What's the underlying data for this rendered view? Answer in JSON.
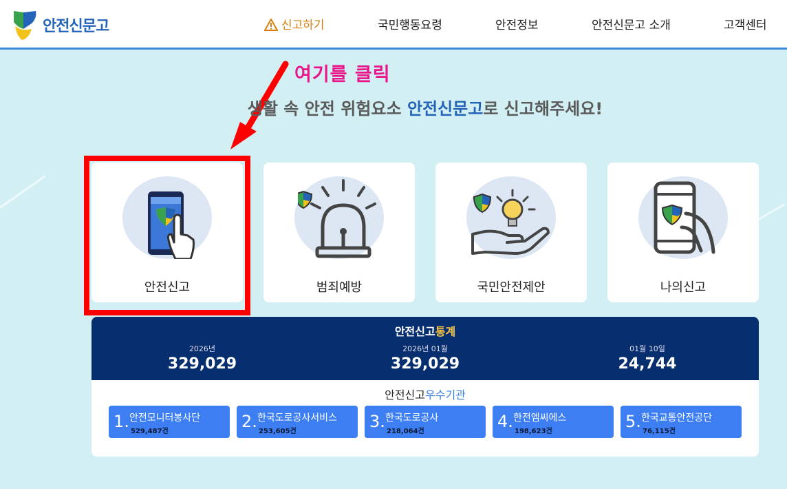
{
  "brand": {
    "name": "안전신문고"
  },
  "nav": [
    {
      "label": "신고하기"
    },
    {
      "label": "국민행동요령"
    },
    {
      "label": "안전정보"
    },
    {
      "label": "안전신문고 소개"
    },
    {
      "label": "고객센터"
    }
  ],
  "annotation": {
    "text": "여기를 클릭"
  },
  "headline": {
    "before": "생활 속 안전 위험요소 ",
    "highlight": "안전신문고",
    "after": "로 신고해주세요!"
  },
  "cards": [
    {
      "label": "안전신고",
      "icon": "phone-touch-icon"
    },
    {
      "label": "범죄예방",
      "icon": "siren-icon"
    },
    {
      "label": "국민안전제안",
      "icon": "lightbulb-hand-icon"
    },
    {
      "label": "나의신고",
      "icon": "hand-phone-icon"
    }
  ],
  "stats": {
    "title_before": "안전신고",
    "title_highlight": "통계",
    "items": [
      {
        "label": "2026년",
        "value": "329,029"
      },
      {
        "label": "2026년 01월",
        "value": "329,029"
      },
      {
        "label": "01월 10일",
        "value": "24,744"
      }
    ]
  },
  "orgs": {
    "title_before": "안전신고",
    "title_highlight": "우수기관",
    "items": [
      {
        "num": "1.",
        "name": "안전모니터봉사단",
        "count": "529,487건"
      },
      {
        "num": "2.",
        "name": "한국도로공사서비스",
        "count": "253,605건"
      },
      {
        "num": "3.",
        "name": "한국도로공사",
        "count": "218,064건"
      },
      {
        "num": "4.",
        "name": "한전엠씨에스",
        "count": "198,623건"
      },
      {
        "num": "5.",
        "name": "한국교통안전공단",
        "count": "76,115건"
      }
    ]
  },
  "colors": {
    "header_border": "#3a8ad8",
    "stats_bg": "#072f70",
    "org_bg": "#3d7ff2",
    "annotation": "#e8168a",
    "highlight_box": "#ff0000"
  }
}
